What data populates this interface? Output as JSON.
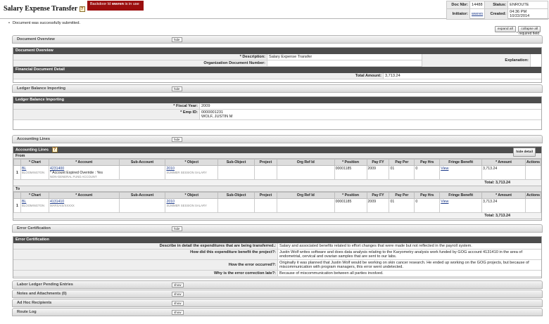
{
  "header": {
    "title": "Salary Expense Transfer",
    "help": "?",
    "backdoor_prefix": "Backdoor Id ",
    "backdoor_user": "wwren",
    "backdoor_suffix": " is in use",
    "doc_nbr_label": "Doc Nbr:",
    "doc_nbr": "14488",
    "status_label": "Status:",
    "status": "ENROUTE",
    "initiator_label": "Initiator:",
    "initiator": "wwren",
    "created_label": "Created:",
    "created": "04:36 PM 10/22/2014"
  },
  "messages": {
    "submitted": "Document was successfully submitted."
  },
  "toolbar": {
    "expand_all": "expand all",
    "collapse_all": "collapse all",
    "required": "* required field"
  },
  "tabs": {
    "document_overview": "Document Overview",
    "ledger_balance": "Ledger Balance Importing",
    "accounting_lines": "Accounting Lines",
    "error_certification": "Error Certification",
    "pending_entries": "Labor Ledger Pending Entries",
    "notes": "Notes and Attachments (0)",
    "adhoc": "Ad Hoc Recipients",
    "route_log": "Route Log",
    "hide": "hide",
    "show": "show"
  },
  "overview": {
    "header": "Document Overview",
    "description_label": "* Description:",
    "description": "Salary Expense Transfer",
    "explanation_label": "Explanation:",
    "org_doc_label": "Organization Document Number:",
    "financial_header": "Financial Document Detail",
    "total_label": "Total Amount:",
    "total": "3,713.24"
  },
  "ledger": {
    "header": "Ledger Balance Importing",
    "fiscal_year_label": "* Fiscal Year:",
    "fiscal_year": "2009",
    "emp_id_label": "* Emp ID:",
    "emp_id": "0000001231",
    "emp_name": "WOLF, JUSTIN M"
  },
  "accounting": {
    "header": "Accounting Lines",
    "hide_detail": "hide detail",
    "from_label": "From",
    "to_label": "To",
    "columns": [
      "* Chart",
      "* Account",
      "Sub-Account",
      "* Object",
      "Sub-Object",
      "Project",
      "Org Ref Id",
      "* Position",
      "Pay FY",
      "Pay Per",
      "Pay Hrs",
      "Fringe Benefit",
      "* Amount",
      "Actions"
    ],
    "from_line": {
      "num": "1",
      "chart": "BL",
      "chart_desc": "BLOOMINGTON",
      "account": "4231400",
      "account_note": "* Account Expired Override : Yes",
      "account_desc": "NON-GENERAL FUND ACCOUNT",
      "object": "2010",
      "object_desc": "SUMMER SESSION SALARY",
      "position": "00001185",
      "pay_fy": "2009",
      "pay_per": "01",
      "pay_hrs": "0",
      "fringe": "View",
      "amount": "3,713.24"
    },
    "from_total": "Total: 3,713.24",
    "to_line": {
      "num": "1",
      "chart": "BL",
      "chart_desc": "BLOOMINGTON",
      "account": "4131410",
      "account_desc": "MARSAIS/XXXXX",
      "object": "2010",
      "object_desc": "SUMMER SESSION SALARY",
      "position": "00001185",
      "pay_fy": "2009",
      "pay_per": "01",
      "pay_hrs": "0",
      "fringe": "View",
      "amount": "3,713.24"
    },
    "to_total": "Total: 3,713.24"
  },
  "error_cert": {
    "header": "Error Certification",
    "q1": "Describe in detail the expenditures that are being transferred.:",
    "a1": "Salary and associated benefits related to effort changes that were made but not reflected in the payroll system.",
    "q2": "How did this expenditure benefit the project?:",
    "a2": "Justin Wolf writes software and does data analysis relating to the Karyometry analysis work funded by GOG account 4131410 in the area of endometrial, cervical and ovarian samples that are sent to our labs.",
    "q3": "How the error occurred?:",
    "a3": "Originally it was planned that Justin Wolf would be working on skin cancer research. He ended up working on the GOG projects, but because of miscommunication with program managers, this error went undetected.",
    "q4": "Why is the error correction late?:",
    "a4": "Because of miscommunication between all parties involved."
  }
}
